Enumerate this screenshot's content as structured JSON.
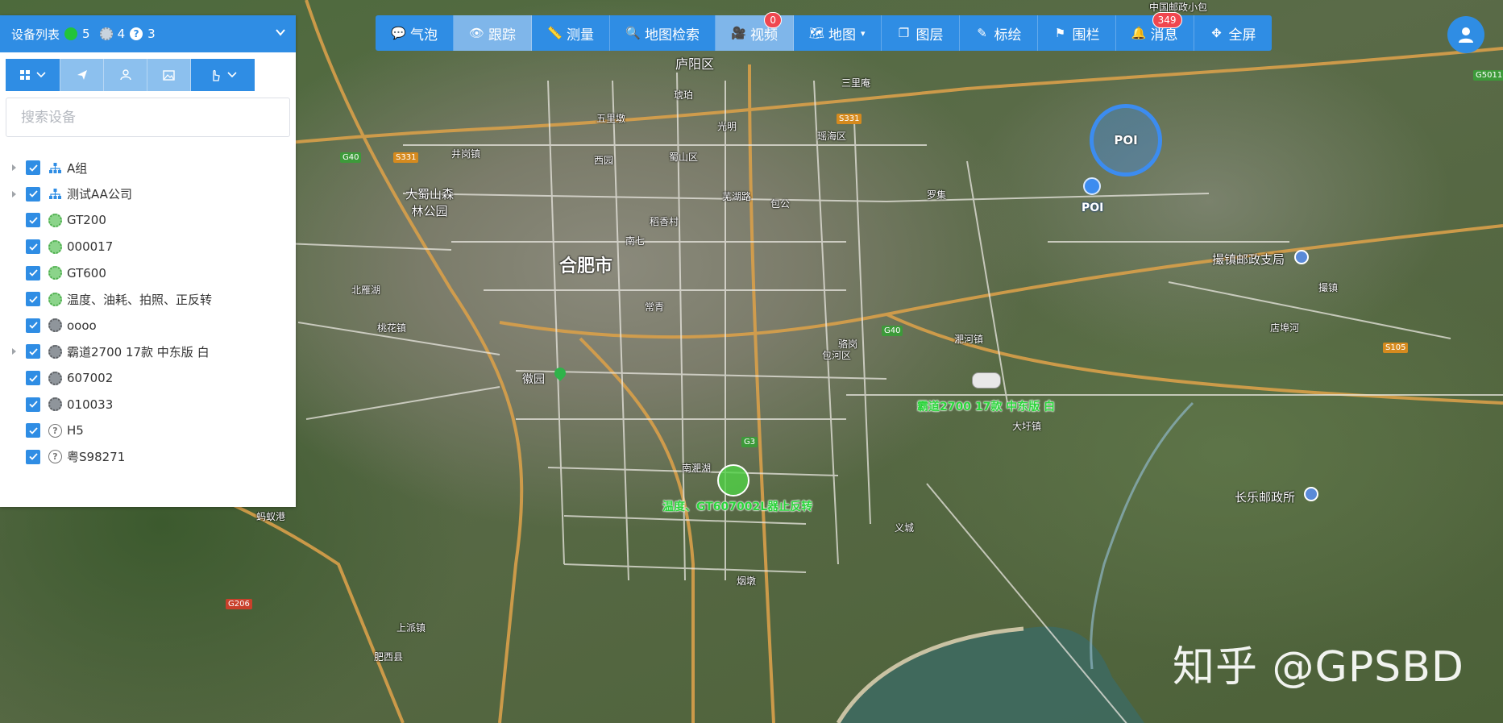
{
  "panel": {
    "title": "设备列表",
    "online_count": "5",
    "offline_count": "4",
    "unknown_count": "3",
    "search_placeholder": "搜索设备",
    "tree": [
      {
        "label": "A组",
        "type": "group",
        "expandable": true
      },
      {
        "label": "测试AA公司",
        "type": "group",
        "expandable": true
      },
      {
        "label": "GT200",
        "type": "online",
        "expandable": false
      },
      {
        "label": "000017",
        "type": "online",
        "expandable": false
      },
      {
        "label": "GT600",
        "type": "online",
        "expandable": false
      },
      {
        "label": "温度、油耗、拍照、正反转",
        "type": "online",
        "expandable": false
      },
      {
        "label": "oooo",
        "type": "offline",
        "expandable": false
      },
      {
        "label": "霸道2700 17款 中东版 白",
        "type": "offline",
        "expandable": true
      },
      {
        "label": "607002",
        "type": "offline",
        "expandable": false
      },
      {
        "label": "010033",
        "type": "offline",
        "expandable": false
      },
      {
        "label": "H5",
        "type": "unknown",
        "expandable": false
      },
      {
        "label": "粤S98271",
        "type": "unknown",
        "expandable": false
      }
    ]
  },
  "toolbar": {
    "items": [
      {
        "label": "气泡",
        "icon": "chat-bubble-icon"
      },
      {
        "label": "跟踪",
        "icon": "eye-icon",
        "active": true
      },
      {
        "label": "测量",
        "icon": "ruler-icon"
      },
      {
        "label": "地图检索",
        "icon": "search-icon"
      },
      {
        "label": "视频",
        "icon": "video-off-icon",
        "active": true,
        "badge": "0"
      },
      {
        "label": "地图",
        "icon": "map-icon",
        "dropdown": true
      },
      {
        "label": "图层",
        "icon": "layers-icon"
      },
      {
        "label": "标绘",
        "icon": "brush-icon"
      },
      {
        "label": "围栏",
        "icon": "fence-icon"
      },
      {
        "label": "消息",
        "icon": "bell-icon",
        "badge": "349"
      },
      {
        "label": "全屏",
        "icon": "fullscreen-icon"
      }
    ]
  },
  "map": {
    "city_label": "合肥市",
    "labels": [
      "庐阳区",
      "中国邮政小包",
      "蜀山区",
      "包河区",
      "瑶海区",
      "五里墩",
      "琥珀",
      "光明",
      "三里庵",
      "西园",
      "南七",
      "稻香村",
      "芜湖路",
      "包公",
      "常青",
      "骆岗",
      "罗集",
      "撮镇邮政支局",
      "长乐邮政所",
      "南淝湖",
      "肥西县",
      "义城",
      "烟墩",
      "上派镇",
      "北雁湖",
      "桃花镇",
      "井岗镇",
      "淝河镇",
      "大圩镇",
      "店埠河",
      "蚂蚁港",
      "撮镇"
    ],
    "park_label": "大蜀山森林公园",
    "huiyuan": "徽园",
    "poi_label": "POI",
    "vehicle_labels": [
      "霸道2700 17款 中东版 白",
      "温度、GT607002L器止反转"
    ],
    "roads": [
      "S331",
      "G40",
      "G3",
      "S105",
      "G206",
      "G5011",
      "G40",
      "S331"
    ],
    "watermark": "知乎 @GPSBD"
  },
  "colors": {
    "primary": "#2f8de4",
    "light": "#8cc0ee",
    "online": "#22c43a",
    "badge": "#f0474f"
  }
}
